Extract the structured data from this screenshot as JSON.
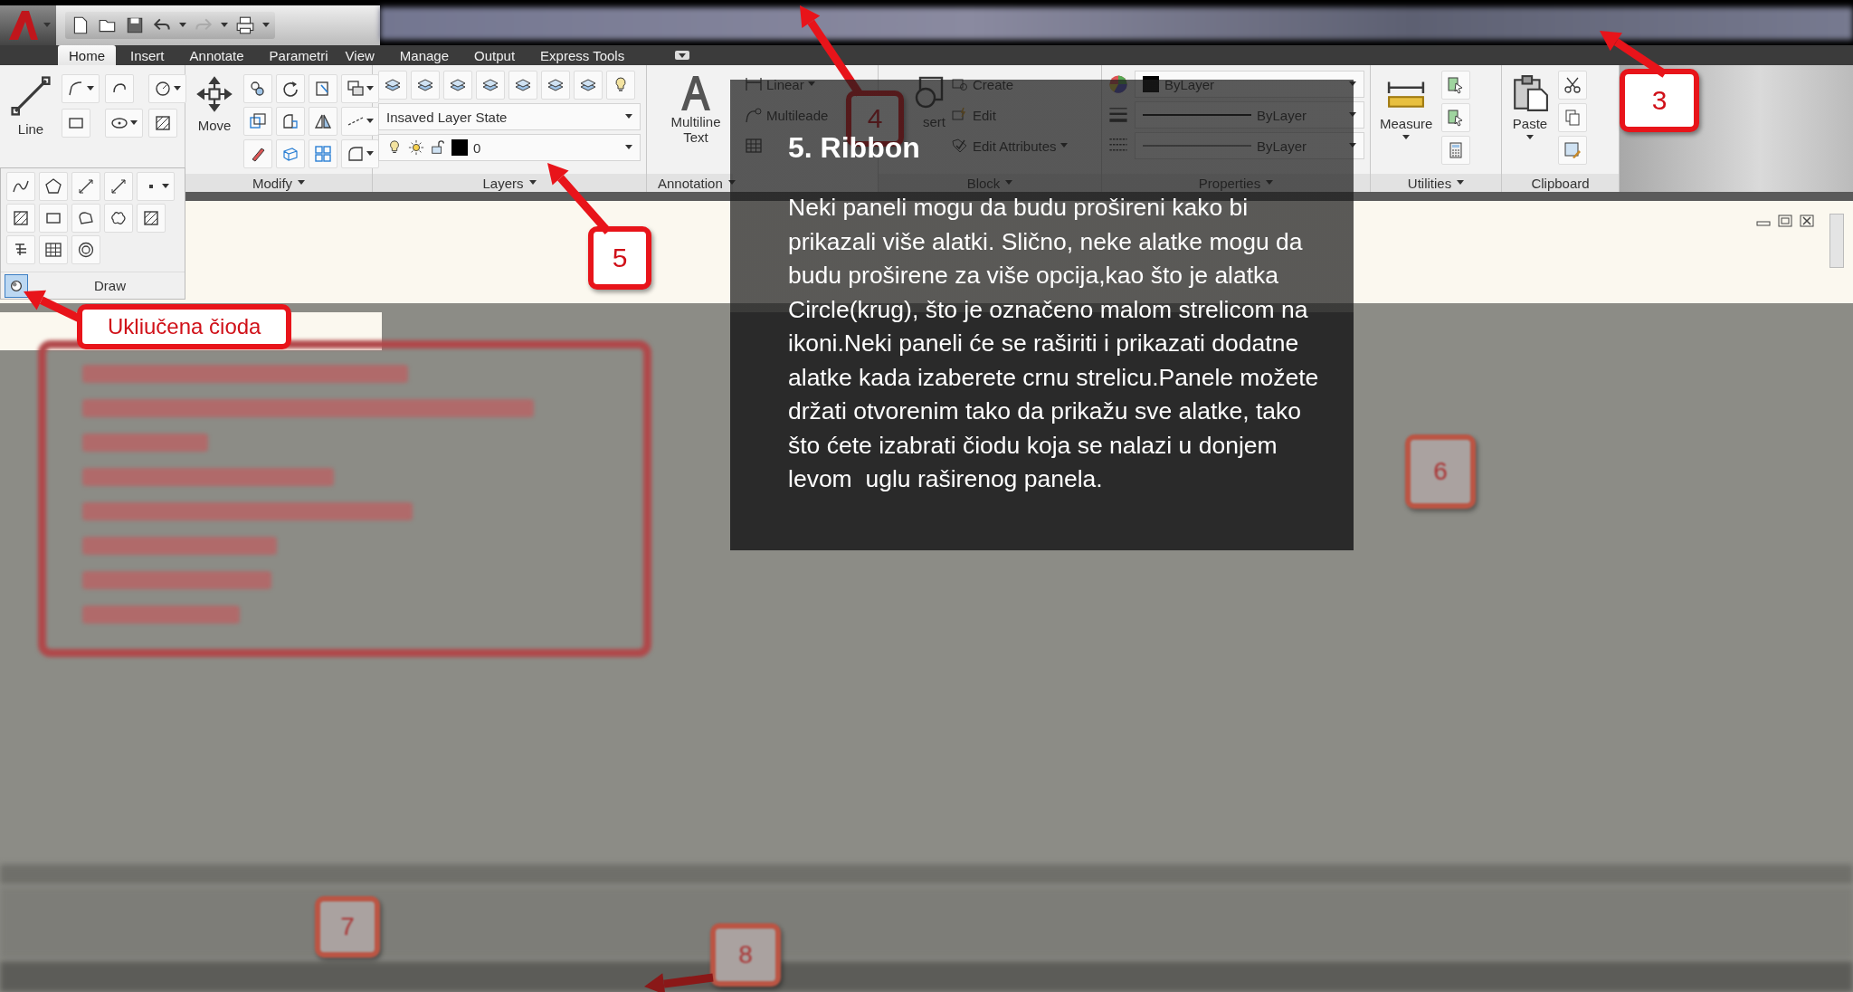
{
  "tabs": [
    {
      "label": "Home",
      "selected": true
    },
    {
      "label": "Insert",
      "selected": false
    },
    {
      "label": "Annotate",
      "selected": false
    },
    {
      "label": "Parametri",
      "selected": false
    },
    {
      "label": "View",
      "selected": false
    },
    {
      "label": "Manage",
      "selected": false
    },
    {
      "label": "Output",
      "selected": false
    },
    {
      "label": "Express Tools",
      "selected": false
    }
  ],
  "panels": {
    "draw": {
      "label": "Draw",
      "big_tool": "Line",
      "pinned": true
    },
    "modify": {
      "label": "Modify",
      "big_tool": "Move"
    },
    "layers": {
      "label": "Layers",
      "layer_state": "Insaved Layer State",
      "current_layer": "0"
    },
    "annotation": {
      "label": "Annotation",
      "big_tool": "Multiline Text",
      "tools": [
        "Linear",
        "Multileade"
      ]
    },
    "block": {
      "label": "Block",
      "big_tool": "sert",
      "tools": [
        "Create",
        "Edit",
        "Edit Attributes"
      ]
    },
    "properties": {
      "label": "Properties",
      "values": [
        "ByLayer",
        "ByLayer",
        "ByLayer"
      ]
    },
    "utilities": {
      "label": "Utilities",
      "big_tool": "Measure"
    },
    "clipboard": {
      "label": "Clipboard",
      "big_tool": "Paste"
    }
  },
  "pin_callout": {
    "label": "Ukliučena čioda"
  },
  "callouts": [
    {
      "number": "3",
      "blurred": false
    },
    {
      "number": "4",
      "blurred": false
    },
    {
      "number": "5",
      "blurred": false
    },
    {
      "number": "6",
      "blurred": true
    },
    {
      "number": "7",
      "blurred": true
    },
    {
      "number": "8",
      "blurred": true
    }
  ],
  "info_box": {
    "title": "5. Ribbon",
    "body": "Neki paneli mogu da budu prošireni kako bi prikazali više alatki. Slično, neke alatke mogu da budu proširene za više opcija,kao što je alatka Circle(krug), što je označeno malom strelicom na ikoni.Neki paneli će se raširiti i prikazati dodatne alatke kada izaberete crnu strelicu.Panele možete držati otvorenim tako da prikažu sve alatke, tako što ćete izabrati čiodu koja se nalazi u donjem levom  uglu raširenog panela."
  }
}
